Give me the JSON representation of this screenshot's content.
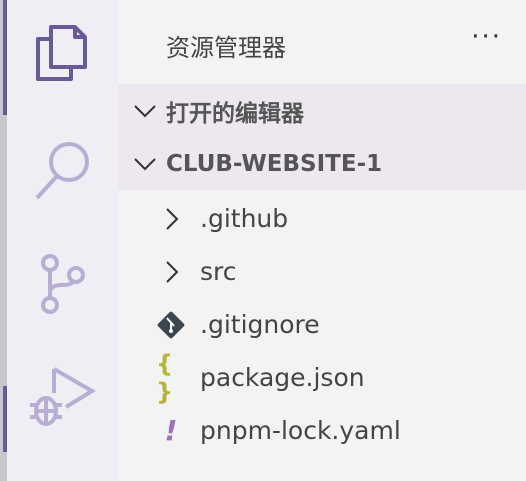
{
  "activity_bar": {
    "items": [
      {
        "name": "explorer",
        "icon": "files-icon",
        "active": true
      },
      {
        "name": "search",
        "icon": "search-icon"
      },
      {
        "name": "source-control",
        "icon": "source-control-icon"
      },
      {
        "name": "run-debug",
        "icon": "run-debug-icon"
      }
    ]
  },
  "sidebar": {
    "title": "资源管理器",
    "more": "···",
    "sections": [
      {
        "label": "打开的编辑器",
        "expanded": true
      },
      {
        "label": "CLUB-WEBSITE-1",
        "expanded": true
      }
    ],
    "tree": [
      {
        "label": ".github",
        "type": "folder"
      },
      {
        "label": "src",
        "type": "folder"
      },
      {
        "label": ".gitignore",
        "type": "file",
        "icon": "git-icon"
      },
      {
        "label": "package.json",
        "type": "file",
        "icon": "json-braces-icon"
      },
      {
        "label": "pnpm-lock.yaml",
        "type": "file",
        "icon": "yaml-exclamation-icon"
      }
    ]
  },
  "colors": {
    "accent": "#6b5a9a",
    "inactive_icon": "#b8aed4",
    "section_band": "#ede8ef",
    "json_icon": "#b5b53a",
    "yaml_icon": "#9b6fc2"
  }
}
